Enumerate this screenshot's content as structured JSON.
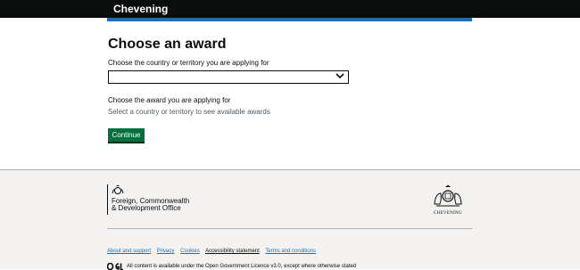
{
  "header": {
    "brand": "Chevening"
  },
  "main": {
    "title": "Choose an award",
    "country_label": "Choose the country or territory you are applying for",
    "country_value": "",
    "award_label": "Choose the award you are applying for",
    "award_hint": "Select a country or territory to see available awards",
    "continue_label": "Continue"
  },
  "footer": {
    "fcdo_line1": "Foreign, Commonwealth",
    "fcdo_line2": "& Development Office",
    "crest_caption": "CHEVENING",
    "links": [
      "About and support",
      "Privacy",
      "Cookies",
      "Accessibility statement",
      "Terms and conditions"
    ],
    "licence_text": "All content is available under the Open Government Licence v3.0, except where otherwise stated"
  },
  "colors": {
    "header_bg": "#0b0c0c",
    "header_bar": "#1d70b8",
    "button": "#00703c",
    "link": "#1d70b8",
    "footer_bg": "#f3f2f1"
  },
  "icons": [
    "chevron-down-icon",
    "royal-crest-icon",
    "ogl-logo-icon"
  ]
}
